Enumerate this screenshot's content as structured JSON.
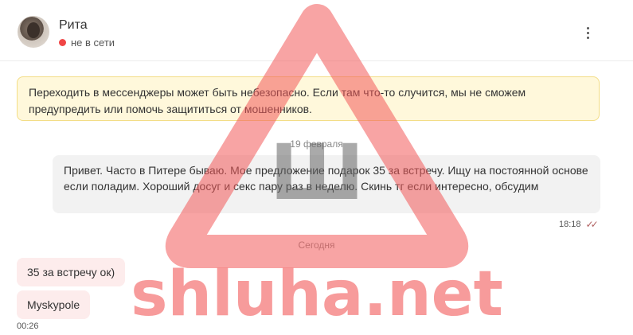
{
  "contact": {
    "name": "Рита",
    "status": "не в сети"
  },
  "warning": {
    "text": "Переходить в мессенджеры может быть небезопасно. Если там что-то случится, мы не сможем предупредить или помочь защититься от мошенников."
  },
  "date_separators": {
    "first": "19 февраля",
    "second": "Сегодня"
  },
  "messages": {
    "outgoing": {
      "text": "Привет. Часто в Питере бываю. Мое предложение подарок 35 за встречу. Ищу на постоянной основе если поладим. Хороший досуг и секс пару раз в неделю. Скинь тг если интересно, обсудим",
      "time": "18:18"
    },
    "incoming": [
      {
        "text": "35 за встречу ок)"
      },
      {
        "text": "Myskypole"
      }
    ],
    "incoming_time": "00:26"
  },
  "watermark": {
    "letter": "Ш",
    "text": "shluha.net",
    "color": "#f25a5a"
  },
  "icons": {
    "menu": "kebab-menu-icon",
    "read_status": "double-check-icon",
    "online_status": "status-dot-icon"
  }
}
